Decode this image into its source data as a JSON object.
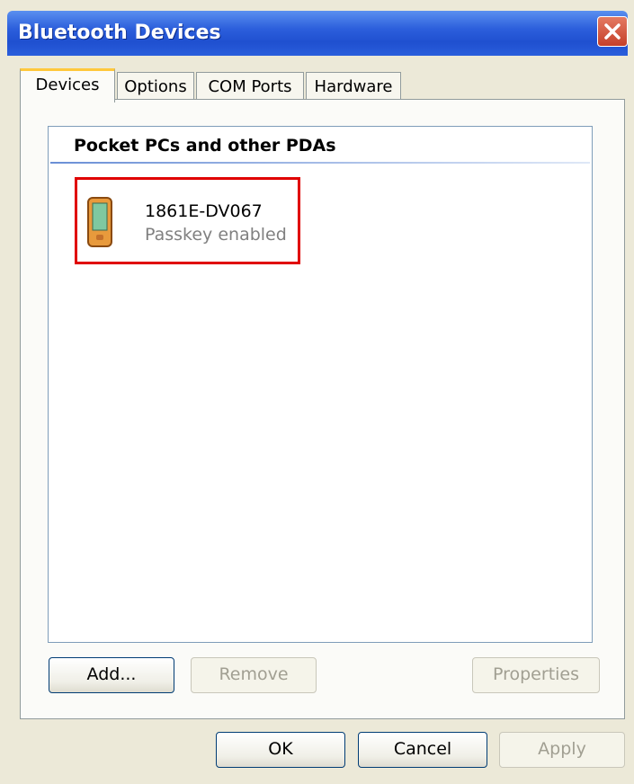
{
  "window": {
    "title": "Bluetooth Devices"
  },
  "tabs": [
    {
      "label": "Devices",
      "active": true
    },
    {
      "label": "Options",
      "active": false
    },
    {
      "label": "COM Ports",
      "active": false
    },
    {
      "label": "Hardware",
      "active": false
    }
  ],
  "device_list": {
    "group_header": "Pocket PCs and other PDAs",
    "devices": [
      {
        "name": "1861E-DV067",
        "status": "Passkey enabled",
        "icon": "pda-icon"
      }
    ]
  },
  "panel_buttons": {
    "add": "Add...",
    "remove": "Remove",
    "properties": "Properties"
  },
  "dialog_buttons": {
    "ok": "OK",
    "cancel": "Cancel",
    "apply": "Apply"
  },
  "colors": {
    "titlebar": "#2c5fdc",
    "highlight_box": "#e00000",
    "active_tab_accent": "#ffc83c"
  }
}
